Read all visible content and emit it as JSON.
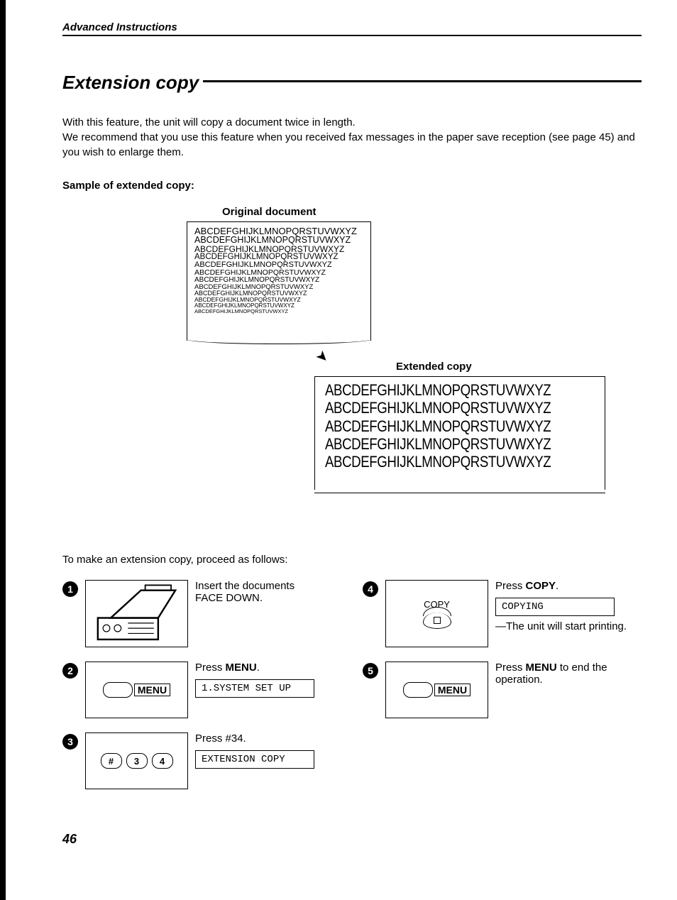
{
  "header": "Advanced Instructions",
  "title": "Extension copy",
  "intro1": "With this feature, the unit will copy a document twice in length.",
  "intro2": "We recommend that you use this feature when you received fax messages in the paper save reception (see page 45) and you wish to enlarge them.",
  "sample_label": "Sample of extended copy:",
  "original_label": "Original document",
  "extended_label": "Extended copy",
  "alphabet": "ABCDEFGHIJKLMNOPQRSTUVWXYZ",
  "ext_partial": "ABCDEFGHIJKLMNOPQRSTUVWXYZ",
  "proceed": "To make an extension copy, proceed as follows:",
  "steps": {
    "s1": {
      "text_a": "Insert the documents",
      "text_b": "FACE DOWN."
    },
    "s2": {
      "text_a": "Press ",
      "bold": "MENU",
      "text_b": ".",
      "lcd": "1.SYSTEM SET UP",
      "btn": "MENU"
    },
    "s3": {
      "text_a": "Press #34.",
      "lcd": "EXTENSION COPY",
      "k1": "#",
      "k2": "3",
      "k3": "4"
    },
    "s4": {
      "text_a": "Press ",
      "bold": "COPY",
      "text_b": ".",
      "lcd": "COPYING",
      "note": "—The unit will start printing.",
      "btn_label": "COPY"
    },
    "s5": {
      "text_a": "Press ",
      "bold": "MENU",
      "text_b": " to end the operation.",
      "btn": "MENU"
    }
  },
  "page_number": "46"
}
